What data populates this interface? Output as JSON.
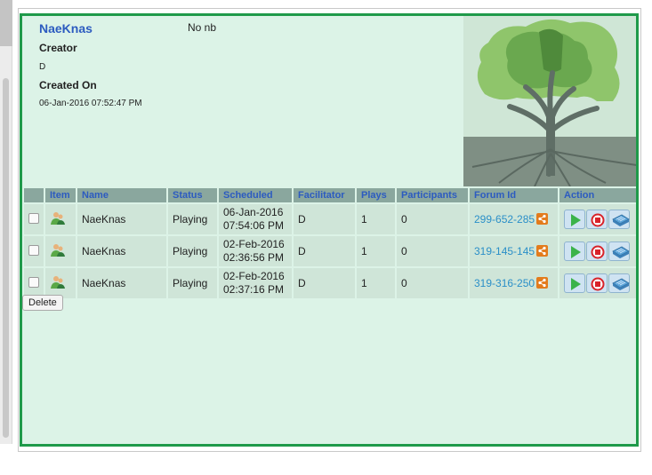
{
  "header": {
    "title": "NaeKnas",
    "description": "No nb",
    "creator_label": "Creator",
    "creator_value": "D",
    "created_label": "Created On",
    "created_value": "06-Jan-2016 07:52:47 PM"
  },
  "table": {
    "columns": [
      "",
      "Item",
      "Name",
      "Status",
      "Scheduled",
      "Facilitator",
      "Plays",
      "Participants",
      "Forum Id",
      "Action"
    ],
    "rows": [
      {
        "name": "NaeKnas",
        "status": "Playing",
        "scheduled_date": "06-Jan-2016",
        "scheduled_time": "07:54:06 PM",
        "facilitator": "D",
        "plays": "1",
        "participants": "0",
        "forum_id": "299-652-285"
      },
      {
        "name": "NaeKnas",
        "status": "Playing",
        "scheduled_date": "02-Feb-2016",
        "scheduled_time": "02:36:56 PM",
        "facilitator": "D",
        "plays": "1",
        "participants": "0",
        "forum_id": "319-145-145"
      },
      {
        "name": "NaeKnas",
        "status": "Playing",
        "scheduled_date": "02-Feb-2016",
        "scheduled_time": "02:37:16 PM",
        "facilitator": "D",
        "plays": "1",
        "participants": "0",
        "forum_id": "319-316-250"
      }
    ]
  },
  "delete_label": "Delete",
  "colors": {
    "panel_border": "#1f9a4a",
    "panel_bg": "#dcf3e7",
    "header_row": "#8aa79e",
    "link": "#2a8fc8",
    "title": "#2c5bc0",
    "share": "#e37b1c"
  },
  "icons": [
    "users-icon",
    "share-icon",
    "play-icon",
    "stop-icon",
    "board-icon",
    "tree-image"
  ]
}
